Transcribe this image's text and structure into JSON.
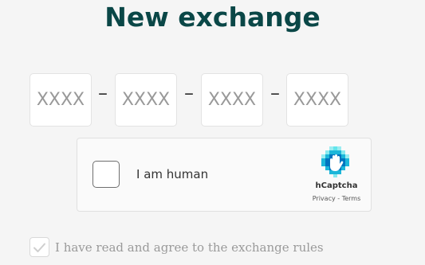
{
  "title": "New exchange",
  "code_inputs": [
    {
      "placeholder": "XXXX",
      "value": ""
    },
    {
      "placeholder": "XXXX",
      "value": ""
    },
    {
      "placeholder": "XXXX",
      "value": ""
    },
    {
      "placeholder": "XXXX",
      "value": ""
    }
  ],
  "separator": "–",
  "captcha": {
    "label": "I am human",
    "brand": "hCaptcha",
    "privacy_link": "Privacy",
    "links_separator": " - ",
    "terms_link": "Terms",
    "logo_icon": "hcaptcha-hand-icon",
    "logo_colors": [
      "#0074bf",
      "#1cb6d9",
      "#3ce0e8"
    ]
  },
  "agreement": {
    "label": "I have read and agree to the exchange rules",
    "checked": true,
    "check_color": "#cfcfcf"
  },
  "colors": {
    "title": "#0a4747",
    "background": "#f5f5f5"
  }
}
